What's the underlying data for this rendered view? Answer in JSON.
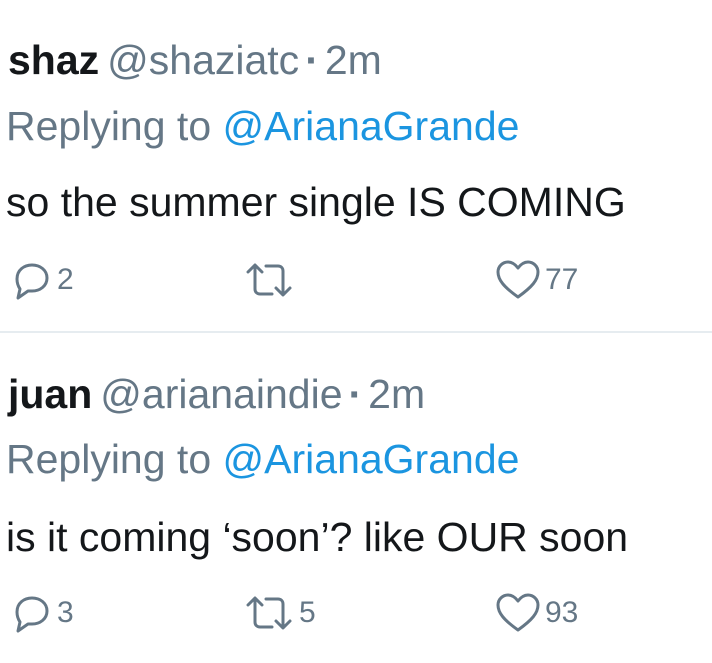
{
  "tweets": [
    {
      "name": "shaz",
      "handle": "@shaziatc",
      "separator": "·",
      "time": "2m",
      "replying_prefix": "Replying to",
      "replying_to": "@ArianaGrande",
      "text": "so the summer single IS COMING",
      "reply_count": "2",
      "retweet_count": "",
      "like_count": "77"
    },
    {
      "name": "juan",
      "handle": "@arianaindie",
      "separator": "·",
      "time": "2m",
      "replying_prefix": "Replying to",
      "replying_to": "@ArianaGrande",
      "text": "is it coming ‘soon’? like OUR soon",
      "reply_count": "3",
      "retweet_count": "5",
      "like_count": "93"
    }
  ],
  "icons": {
    "reply": "reply-icon",
    "retweet": "retweet-icon",
    "like": "heart-icon"
  },
  "colors": {
    "name": "#14171a",
    "secondary": "#657786",
    "mention": "#1b95e0",
    "divider": "#e6ecf0",
    "background": "#ffffff"
  }
}
